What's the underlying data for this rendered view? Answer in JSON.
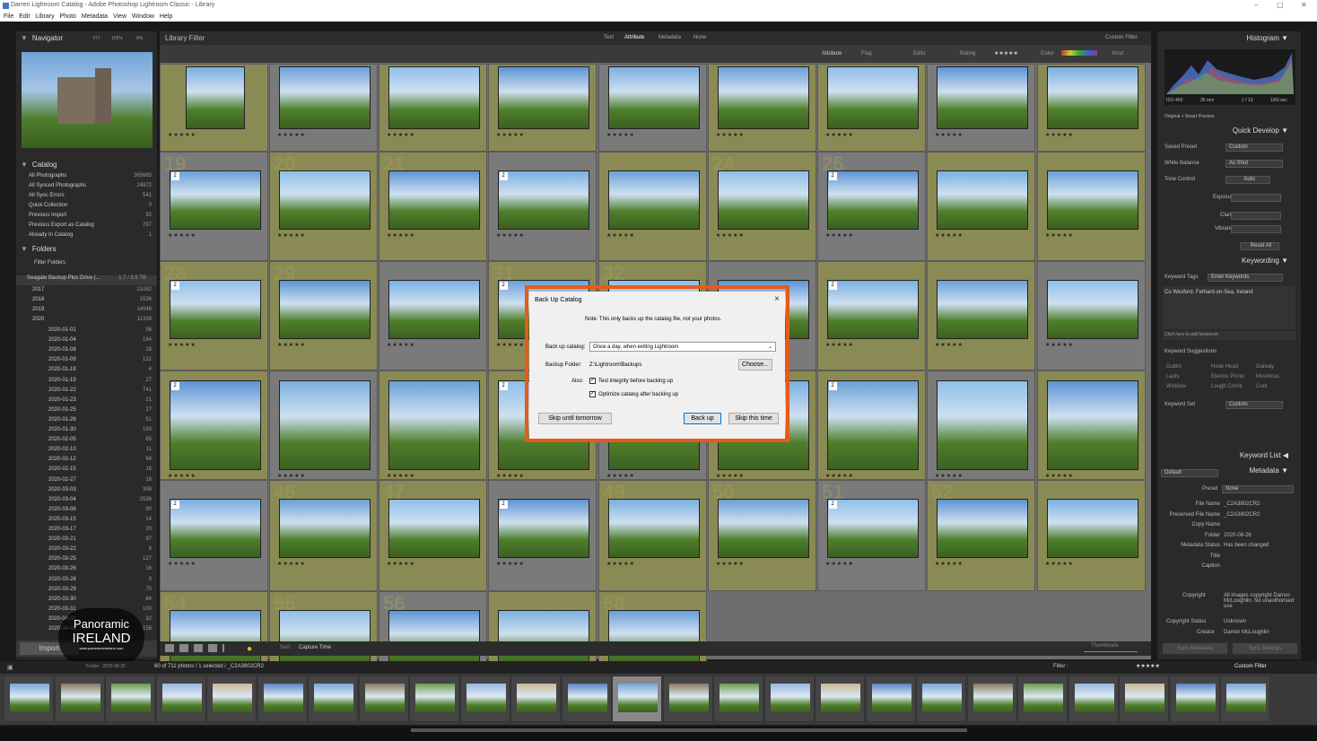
{
  "window": {
    "title": "Darren Lightroom Catalog - Adobe Photoshop Lightroom Classic - Library",
    "min": "–",
    "max": "▢",
    "close": "✕"
  },
  "menu": [
    "File",
    "Edit",
    "Library",
    "Photo",
    "Metadata",
    "View",
    "Window",
    "Help"
  ],
  "navigator": {
    "title": "Navigator",
    "fit": "FIT",
    "zoom1": "100%",
    "zoom2": "8%"
  },
  "catalog": {
    "title": "Catalog",
    "items": [
      {
        "label": "All Photographs",
        "count": "265665"
      },
      {
        "label": "All Synced Photographs",
        "count": "24872"
      },
      {
        "label": "All Sync Errors",
        "count": "541"
      },
      {
        "label": "Quick Collection",
        "count": "0"
      },
      {
        "label": "Previous Import",
        "count": "92"
      },
      {
        "label": "Previous Export as Catalog",
        "count": "787"
      },
      {
        "label": "Already In Catalog",
        "count": "1"
      }
    ]
  },
  "folders": {
    "title": "Folders",
    "filter": "Filter Folders",
    "drive": "Seagate Backup Plus Drive (...",
    "drive_size": "1.7 / 5.5 TB",
    "years": [
      {
        "label": "2017",
        "count": "21052"
      },
      {
        "label": "2018",
        "count": "1536"
      },
      {
        "label": "2019",
        "count": "14048"
      },
      {
        "label": "2020",
        "count": "11339"
      }
    ],
    "items": [
      {
        "label": "2020-01-01",
        "count": "56"
      },
      {
        "label": "2020-01-04",
        "count": "164"
      },
      {
        "label": "2020-01-08",
        "count": "28"
      },
      {
        "label": "2020-01-09",
        "count": "132"
      },
      {
        "label": "2020-01-18",
        "count": "4"
      },
      {
        "label": "2020-01-19",
        "count": "27"
      },
      {
        "label": "2020-01-22",
        "count": "741"
      },
      {
        "label": "2020-01-23",
        "count": "21"
      },
      {
        "label": "2020-01-25",
        "count": "27"
      },
      {
        "label": "2020-01-26",
        "count": "51"
      },
      {
        "label": "2020-01-30",
        "count": "183"
      },
      {
        "label": "2020-02-05",
        "count": "65"
      },
      {
        "label": "2020-02-10",
        "count": "11"
      },
      {
        "label": "2020-02-12",
        "count": "94"
      },
      {
        "label": "2020-02-15",
        "count": "16"
      },
      {
        "label": "2020-02-27",
        "count": "16"
      },
      {
        "label": "2020-03-03",
        "count": "399"
      },
      {
        "label": "2020-03-04",
        "count": "2596"
      },
      {
        "label": "2020-03-08",
        "count": "90"
      },
      {
        "label": "2020-03-15",
        "count": "14"
      },
      {
        "label": "2020-03-17",
        "count": "20"
      },
      {
        "label": "2020-03-21",
        "count": "97"
      },
      {
        "label": "2020-03-22",
        "count": "8"
      },
      {
        "label": "2020-03-25",
        "count": "127"
      },
      {
        "label": "2020-03-26",
        "count": "16"
      },
      {
        "label": "2020-03-28",
        "count": "9"
      },
      {
        "label": "2020-03-29",
        "count": "70"
      },
      {
        "label": "2020-03-30",
        "count": "84"
      },
      {
        "label": "2020-03-31",
        "count": "100"
      },
      {
        "label": "2020-04-01",
        "count": "32"
      },
      {
        "label": "2020-04-02",
        "count": "158"
      }
    ]
  },
  "import_label": "Import",
  "library_filter": {
    "title": "Library Filter",
    "tabs": [
      "Text",
      "Attribute",
      "Metadata",
      "None"
    ],
    "custom": "Custom Filter"
  },
  "attribute_bar": {
    "attribute": "Attribute",
    "flag": "Flag",
    "edits": "Edits",
    "rating": "Rating",
    "stars": "★★★★★",
    "color": "Color",
    "kind": "Kind"
  },
  "grid_numbers": [
    "19",
    "20",
    "21",
    "",
    "",
    "24",
    "25",
    "",
    "",
    "28",
    "29",
    "",
    "31",
    "32",
    "",
    "",
    "",
    "",
    "",
    "",
    "",
    "",
    "",
    "",
    "",
    "",
    "",
    "",
    "46",
    "47",
    "",
    "49",
    "50",
    "51",
    "52",
    "",
    "54",
    "55",
    "56",
    "",
    "58",
    "",
    "60"
  ],
  "histogram": {
    "title": "Histogram",
    "iso": "ISO 400",
    "focal": "35 mm",
    "aperture": "ƒ / 13",
    "shutter": "1/60 sec",
    "original": "Original + Smart Preview"
  },
  "quick_develop": {
    "title": "Quick Develop",
    "saved_preset": "Saved Preset",
    "saved_value": "Custom",
    "wb": "White Balance",
    "wb_value": "As Shot",
    "tone": "Tone Control",
    "auto": "Auto",
    "exposure": "Exposure",
    "clarity": "Clarity",
    "vibrance": "Vibrance",
    "reset": "Reset All"
  },
  "keywording": {
    "title": "Keywording",
    "tags_label": "Keyword Tags",
    "tags_value": "Enter Keywords",
    "keywords": "Co Wexford, Fethard-on-Sea, Ireland",
    "click_add": "Click here to add keywords",
    "suggestions": "Keyword Suggestions",
    "sugg": [
      "Dublin",
      "Hook Head",
      "Galway",
      "Laois",
      "Electric Picnic",
      "Mountcas",
      "Wicklow",
      "Lough Corrib",
      "Cork"
    ],
    "set_label": "Keyword Set",
    "set_value": "Custom"
  },
  "keyword_list": {
    "title": "Keyword List"
  },
  "metadata": {
    "title": "Metadata",
    "default": "Default",
    "preset_label": "Preset",
    "preset_value": "None",
    "fields": [
      {
        "label": "File Name",
        "value": "_C2A3802CR2"
      },
      {
        "label": "Preserved File Name",
        "value": "_C2A3802CR2"
      },
      {
        "label": "Copy Name",
        "value": ""
      },
      {
        "label": "Folder",
        "value": "2020-08-26"
      },
      {
        "label": "Metadata Status",
        "value": "Has been changed"
      },
      {
        "label": "Title",
        "value": ""
      },
      {
        "label": "Caption",
        "value": ""
      }
    ],
    "copyright_label": "Copyright",
    "copyright_value": "All images copyright Darren McLoughlin. No unauthorised use",
    "status_label": "Copyright Status",
    "status_value": "Unknown",
    "creator_label": "Creator",
    "creator_value": "Darren McLoughlin"
  },
  "sync": {
    "metadata": "Sync Metadata",
    "settings": "Sync Settings"
  },
  "toolbar": {
    "sort": "Sort",
    "sort_value": "Capture Time",
    "thumbnails": "Thumbnails"
  },
  "filmbar": {
    "folder": "Folder : 2020-08-26",
    "count": "60 of 711 photos / 1 selected / _C2A3802CR2",
    "filter": "Filter :",
    "custom": "Custom Filter"
  },
  "dialog": {
    "title": "Back Up Catalog",
    "note": "Note: This only backs up the catalog file, not your photos.",
    "backup_label": "Back up catalog:",
    "backup_value": "Once a day, when exiting Lightroom",
    "folder_label": "Backup Folder:",
    "folder_value": "Z:\\Lightroom\\Backups",
    "choose": "Choose...",
    "also": "Also:",
    "test": "Test integrity before backing up",
    "optimize": "Optimize catalog after backing up",
    "skip_tomorrow": "Skip until tomorrow",
    "back_up": "Back up",
    "skip_time": "Skip this time"
  },
  "logo": {
    "line1": "Panoramic",
    "line2": "IRELAND",
    "url": "www.panoramicireland.com"
  },
  "colors": {
    "accent": "#e85a1a",
    "panel": "#2a2a2a",
    "grid": "#6e6e6e",
    "selected": "#8a8a54"
  }
}
